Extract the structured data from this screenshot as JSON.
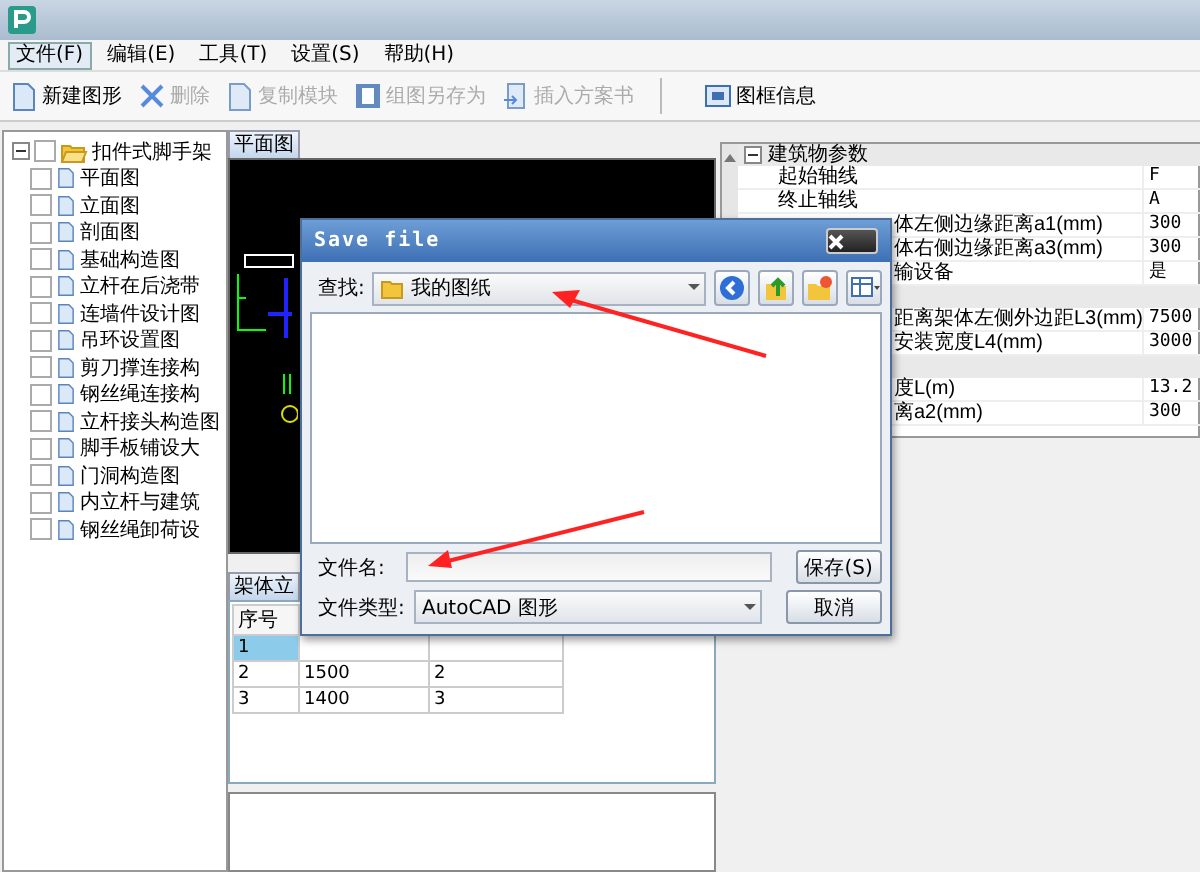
{
  "menu": [
    {
      "label": "文件(F)",
      "selected": true
    },
    {
      "label": "编辑(E)",
      "selected": false
    },
    {
      "label": "工具(T)",
      "selected": false
    },
    {
      "label": "设置(S)",
      "selected": false
    },
    {
      "label": "帮助(H)",
      "selected": false
    }
  ],
  "toolbar": [
    {
      "label": "新建图形",
      "disabled": false,
      "kind": "page"
    },
    {
      "label": "删除",
      "disabled": true,
      "kind": "cross"
    },
    {
      "label": "复制模块",
      "disabled": true,
      "kind": "page"
    },
    {
      "label": "组图另存为",
      "disabled": true,
      "kind": "save"
    },
    {
      "label": "插入方案书",
      "disabled": true,
      "kind": "insert"
    },
    {
      "label": "图框信息",
      "disabled": false,
      "kind": "frame"
    }
  ],
  "tree": {
    "label": "扣件式脚手架",
    "checked": false,
    "expanded": true,
    "children": [
      {
        "label": "平面图",
        "checked": false
      },
      {
        "label": "立面图",
        "checked": false
      },
      {
        "label": "剖面图",
        "checked": false
      },
      {
        "label": "基础构造图",
        "checked": false
      },
      {
        "label": "立杆在后浇带",
        "checked": false
      },
      {
        "label": "连墙件设计图",
        "checked": false
      },
      {
        "label": "吊环设置图",
        "checked": false
      },
      {
        "label": "剪刀撑连接构",
        "checked": false
      },
      {
        "label": "钢丝绳连接构",
        "checked": false
      },
      {
        "label": "立杆接头构造图",
        "checked": false
      },
      {
        "label": "脚手板铺设大",
        "checked": false
      },
      {
        "label": "门洞构造图",
        "checked": false
      },
      {
        "label": "内立杆与建筑",
        "checked": false
      },
      {
        "label": "钢丝绳卸荷设",
        "checked": false
      }
    ]
  },
  "canvas_tab": {
    "label": "平面图",
    "selected": true
  },
  "bottom_tab": {
    "label": "架体立",
    "selected": true
  },
  "table": {
    "columns": [
      "序号"
    ],
    "rows": [
      {
        "cells": [
          "1"
        ],
        "selected": true
      },
      {
        "cells": [
          "2",
          "1500",
          "2"
        ],
        "selected": false
      },
      {
        "cells": [
          "3",
          "1400",
          "3"
        ],
        "selected": false
      }
    ]
  },
  "properties": {
    "groups": [
      {
        "title": "建筑物参数",
        "expanded": true,
        "rows": [
          {
            "name": "起始轴线",
            "value": "F",
            "kind": "full"
          },
          {
            "name": "终止轴线",
            "value": "A",
            "kind": "full"
          },
          {
            "name": "体左侧边缘距离a1(mm)",
            "value": "300",
            "kind": "covered"
          },
          {
            "name": "体右侧边缘距离a3(mm)",
            "value": "300",
            "kind": "covered"
          },
          {
            "name": "输设备",
            "value": "是",
            "kind": "covered"
          }
        ]
      },
      {
        "rows": [
          {
            "name": "距离架体左侧外边距L3(mm)",
            "value": "7500",
            "kind": "covered"
          },
          {
            "name": "安装宽度L4(mm)",
            "value": "3000",
            "kind": "covered"
          }
        ]
      },
      {
        "rows": [
          {
            "name": "度L(m)",
            "value": "13.2",
            "kind": "covered"
          },
          {
            "name": "离a2(mm)",
            "value": "300",
            "kind": "covered"
          }
        ]
      }
    ]
  },
  "dialog": {
    "title": "Save file",
    "look_in_label": "查找:",
    "look_in": "我的图纸",
    "filename_label": "文件名:",
    "filetype_label": "文件类型:",
    "filetype": "AutoCAD 图形",
    "buttons": [
      "保存(S)",
      "取消"
    ]
  }
}
